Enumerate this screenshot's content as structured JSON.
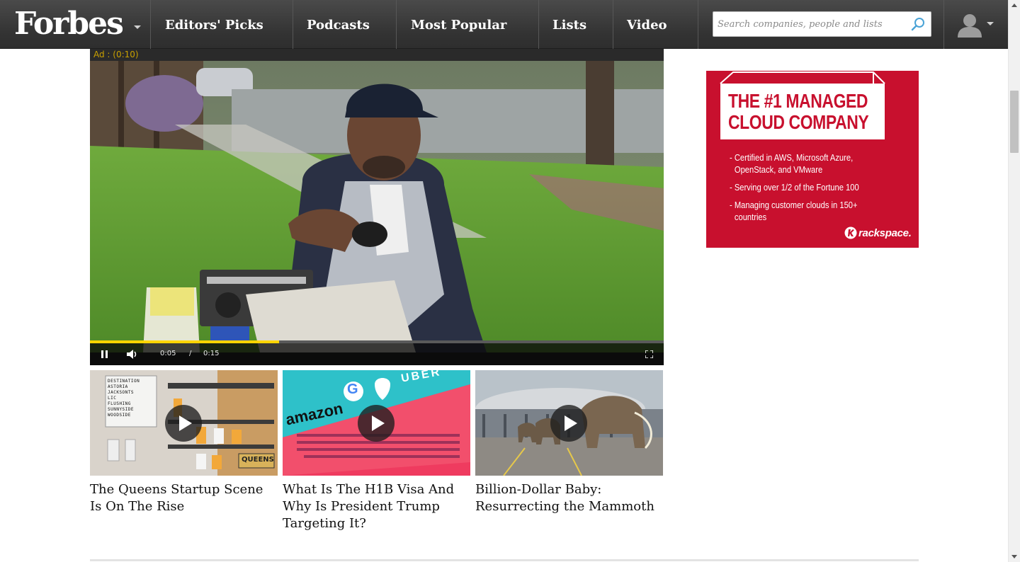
{
  "nav": {
    "logo": "Forbes",
    "items": [
      {
        "label": "Editors' Picks"
      },
      {
        "label": "Podcasts"
      },
      {
        "label": "Most Popular"
      },
      {
        "label": "Lists"
      },
      {
        "label": "Video"
      }
    ],
    "search": {
      "placeholder": "Search companies, people and lists",
      "icon": "search-icon"
    },
    "user": {
      "icon": "user-avatar-icon"
    }
  },
  "player": {
    "ad_label": "Ad : (0:10)",
    "current_time": "0:05",
    "separator": "/",
    "duration": "0:15",
    "progress_fraction": 0.33,
    "progress_color": "#ffd400"
  },
  "videos": [
    {
      "title": "The Queens Startup Scene Is On The Rise",
      "thumb_words": [
        "DESTINATION",
        "ASTORIA",
        "JACKSONTS",
        "LIC",
        "FLUSHING",
        "SUNNYSIDE",
        "WOODSIDE"
      ],
      "sign": "QUEENS"
    },
    {
      "title": "What Is The H1B Visa And Why Is President Trump Targeting It?",
      "logos": [
        "amazon",
        "G",
        "UBER"
      ]
    },
    {
      "title": "Billion-Dollar Baby: Resurrecting the Mammoth"
    }
  ],
  "side_ad": {
    "headline_line1": "THE #1 MANAGED",
    "headline_line2": "CLOUD COMPANY",
    "bullets": [
      "- Certified in AWS, Microsoft Azure, OpenStack, and VMware",
      "- Serving over 1/2 of the Fortune 100",
      "- Managing customer clouds in 150+ countries"
    ],
    "brand": "rackspace.",
    "brand_color": "#c8102e"
  }
}
